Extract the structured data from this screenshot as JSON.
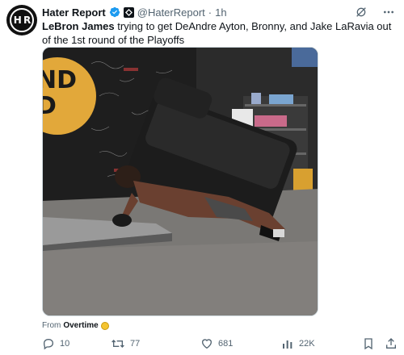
{
  "author": {
    "avatar_text": "H R",
    "display_name": "Hater Report",
    "handle": "@HaterReport",
    "separator": "·",
    "time": "1h"
  },
  "tweet": {
    "bold_name": "LeBron James",
    "text": " trying to get DeAndre Ayton, Bronny, and Jake LaRavia out of the 1st round of the Playoffs"
  },
  "media": {
    "description_icon": "video-thumbnail"
  },
  "source": {
    "prefix": "From",
    "name": "Overtime"
  },
  "actions": {
    "replies": "10",
    "retweets": "77",
    "likes": "681",
    "views": "22K"
  },
  "colors": {
    "muted": "#536471",
    "text": "#0f1419",
    "verified": "#1d9bf0"
  }
}
